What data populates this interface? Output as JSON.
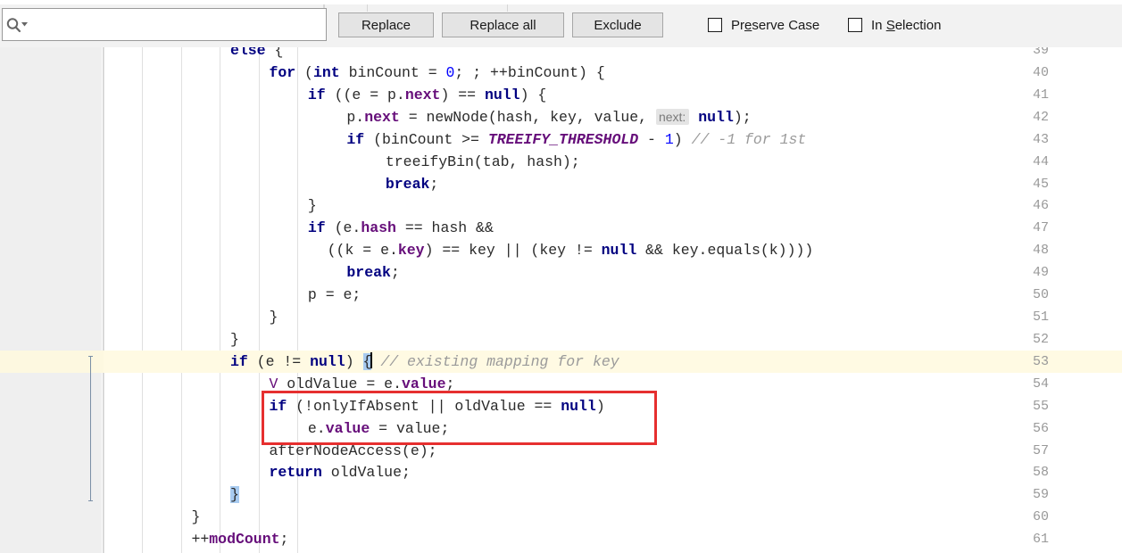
{
  "toolbar": {
    "search": {
      "value": "",
      "placeholder": "",
      "icon": "search-icon"
    },
    "replace_label": "Replace",
    "replace_all_label": "Replace all",
    "exclude_label": "Exclude",
    "preserve_case": {
      "label_a": "Pr",
      "label_b": "e",
      "label_c": "serve Case",
      "checked": false
    },
    "in_selection": {
      "label_a": "In ",
      "label_b": "S",
      "label_c": "election",
      "checked": false
    }
  },
  "editor": {
    "language": "java",
    "current_line": 53,
    "first_line": 39,
    "gutter_line_numbers": [
      "39",
      "40",
      "41",
      "42",
      "43",
      "44",
      "45",
      "46",
      "47",
      "48",
      "49",
      "50",
      "51",
      "52",
      "53",
      "54",
      "55",
      "56",
      "57",
      "58",
      "59",
      "60",
      "61"
    ],
    "annotation": {
      "type": "red-rectangle",
      "color": "#e62f2f",
      "covers_lines": [
        55,
        56
      ]
    },
    "lines": [
      {
        "n": "39",
        "indent": 8,
        "segments": [
          {
            "t": "else",
            "c": "kw"
          },
          {
            "t": " {",
            "c": "plain"
          }
        ]
      },
      {
        "n": "40",
        "indent": 12,
        "segments": [
          {
            "t": "for",
            "c": "kw"
          },
          {
            "t": " (",
            "c": "plain"
          },
          {
            "t": "int",
            "c": "kw"
          },
          {
            "t": " binCount = ",
            "c": "plain"
          },
          {
            "t": "0",
            "c": "num"
          },
          {
            "t": "; ; ++binCount) {",
            "c": "plain"
          }
        ]
      },
      {
        "n": "41",
        "indent": 16,
        "segments": [
          {
            "t": "if",
            "c": "kw"
          },
          {
            "t": " ((e = p.",
            "c": "plain"
          },
          {
            "t": "next",
            "c": "fld"
          },
          {
            "t": ") == ",
            "c": "plain"
          },
          {
            "t": "null",
            "c": "kw"
          },
          {
            "t": ") {",
            "c": "plain"
          }
        ]
      },
      {
        "n": "42",
        "indent": 20,
        "segments": [
          {
            "t": "p.",
            "c": "plain"
          },
          {
            "t": "next",
            "c": "fld"
          },
          {
            "t": " = newNode(hash, key, value, ",
            "c": "plain"
          },
          {
            "t": "next:",
            "c": "hint"
          },
          {
            "t": " ",
            "c": "plain"
          },
          {
            "t": "null",
            "c": "kw"
          },
          {
            "t": ");",
            "c": "plain"
          }
        ]
      },
      {
        "n": "43",
        "indent": 20,
        "segments": [
          {
            "t": "if",
            "c": "kw"
          },
          {
            "t": " (binCount >= ",
            "c": "plain"
          },
          {
            "t": "TREEIFY_THRESHOLD",
            "c": "cnst"
          },
          {
            "t": " - ",
            "c": "plain"
          },
          {
            "t": "1",
            "c": "num"
          },
          {
            "t": ") ",
            "c": "plain"
          },
          {
            "t": "// -1 for 1st",
            "c": "cmt"
          }
        ]
      },
      {
        "n": "44",
        "indent": 24,
        "segments": [
          {
            "t": "treeifyBin(tab, hash);",
            "c": "plain"
          }
        ]
      },
      {
        "n": "45",
        "indent": 24,
        "segments": [
          {
            "t": "break",
            "c": "kw"
          },
          {
            "t": ";",
            "c": "plain"
          }
        ]
      },
      {
        "n": "46",
        "indent": 16,
        "segments": [
          {
            "t": "}",
            "c": "plain"
          }
        ]
      },
      {
        "n": "47",
        "indent": 16,
        "segments": [
          {
            "t": "if",
            "c": "kw"
          },
          {
            "t": " (e.",
            "c": "plain"
          },
          {
            "t": "hash",
            "c": "fld"
          },
          {
            "t": " == hash &&",
            "c": "plain"
          }
        ]
      },
      {
        "n": "48",
        "indent": 18,
        "segments": [
          {
            "t": "((k = e.",
            "c": "plain"
          },
          {
            "t": "key",
            "c": "fld"
          },
          {
            "t": ") == key || (key != ",
            "c": "plain"
          },
          {
            "t": "null",
            "c": "kw"
          },
          {
            "t": " && key.equals(k))))",
            "c": "plain"
          }
        ]
      },
      {
        "n": "49",
        "indent": 20,
        "segments": [
          {
            "t": "break",
            "c": "kw"
          },
          {
            "t": ";",
            "c": "plain"
          }
        ]
      },
      {
        "n": "50",
        "indent": 16,
        "segments": [
          {
            "t": "p = e;",
            "c": "plain"
          }
        ]
      },
      {
        "n": "51",
        "indent": 12,
        "segments": [
          {
            "t": "}",
            "c": "plain"
          }
        ]
      },
      {
        "n": "52",
        "indent": 8,
        "segments": [
          {
            "t": "}",
            "c": "plain"
          }
        ]
      },
      {
        "n": "53",
        "indent": 8,
        "segments": [
          {
            "t": "if",
            "c": "kw"
          },
          {
            "t": " (e != ",
            "c": "plain"
          },
          {
            "t": "null",
            "c": "kw"
          },
          {
            "t": ") ",
            "c": "plain"
          },
          {
            "t": "{",
            "c": "bracematch"
          },
          {
            "t": "CARET",
            "c": "caret"
          },
          {
            "t": " ",
            "c": "plain"
          },
          {
            "t": "// existing mapping for key",
            "c": "cmt"
          }
        ]
      },
      {
        "n": "54",
        "indent": 12,
        "segments": [
          {
            "t": "V",
            "c": "typ"
          },
          {
            "t": " oldValue = e.",
            "c": "plain"
          },
          {
            "t": "value",
            "c": "fld"
          },
          {
            "t": ";",
            "c": "plain"
          }
        ]
      },
      {
        "n": "55",
        "indent": 12,
        "segments": [
          {
            "t": "if",
            "c": "kw"
          },
          {
            "t": " (!onlyIfAbsent || oldValue == ",
            "c": "plain"
          },
          {
            "t": "null",
            "c": "kw"
          },
          {
            "t": ")",
            "c": "plain"
          }
        ]
      },
      {
        "n": "56",
        "indent": 16,
        "segments": [
          {
            "t": "e.",
            "c": "plain"
          },
          {
            "t": "value",
            "c": "fld"
          },
          {
            "t": " = value;",
            "c": "plain"
          }
        ]
      },
      {
        "n": "57",
        "indent": 12,
        "segments": [
          {
            "t": "afterNodeAccess(e);",
            "c": "plain"
          }
        ]
      },
      {
        "n": "58",
        "indent": 12,
        "segments": [
          {
            "t": "return",
            "c": "kw"
          },
          {
            "t": " oldValue;",
            "c": "plain"
          }
        ]
      },
      {
        "n": "59",
        "indent": 8,
        "segments": [
          {
            "t": "}",
            "c": "bracematch"
          }
        ]
      },
      {
        "n": "60",
        "indent": 4,
        "segments": [
          {
            "t": "}",
            "c": "plain"
          }
        ]
      },
      {
        "n": "61",
        "indent": 4,
        "segments": [
          {
            "t": "++",
            "c": "plain"
          },
          {
            "t": "modCount",
            "c": "fld"
          },
          {
            "t": ";",
            "c": "plain"
          }
        ]
      }
    ]
  },
  "colors": {
    "keyword": "#000080",
    "field": "#660e7a",
    "constant": "#660e7a",
    "number": "#0000ff",
    "comment": "#9a9a9a",
    "annotation_red": "#e62f2f",
    "current_line_bg": "#fffae3",
    "brace_match_bg": "#a8cbf0",
    "gutter_bg": "#efefef"
  }
}
